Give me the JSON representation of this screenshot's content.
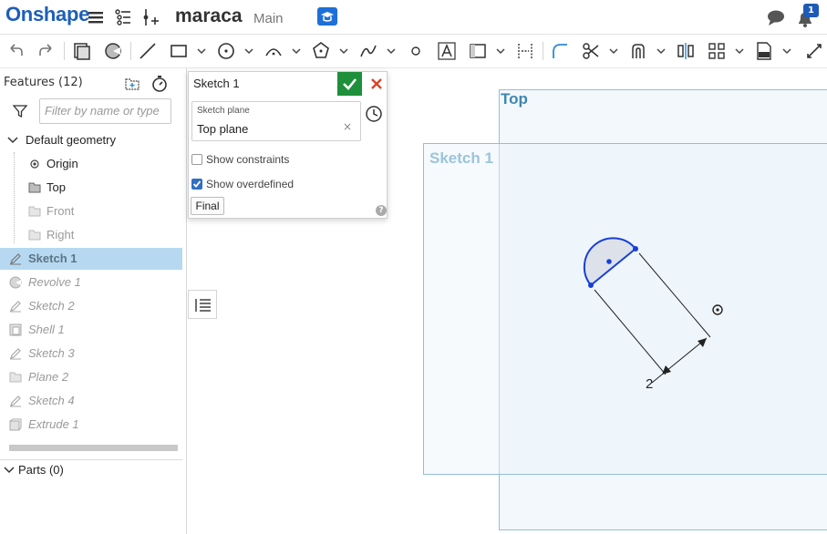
{
  "header": {
    "logo": "Onshape",
    "document_name": "maraca",
    "branch": "Main",
    "notification_count": "1"
  },
  "feature_panel": {
    "title": "Features (12)",
    "filter_placeholder": "Filter by name or type",
    "default_geometry_label": "Default geometry",
    "default_items": [
      "Origin",
      "Top",
      "Front",
      "Right"
    ],
    "features": [
      "Sketch 1",
      "Revolve 1",
      "Sketch 2",
      "Shell 1",
      "Sketch 3",
      "Plane 2",
      "Sketch 4",
      "Extrude 1"
    ],
    "parts_label": "Parts (0)"
  },
  "sketch_dialog": {
    "title": "Sketch 1",
    "plane_label": "Sketch plane",
    "plane_value": "Top plane",
    "show_constraints_label": "Show constraints",
    "show_constraints_checked": false,
    "show_overdefined_label": "Show overdefined",
    "show_overdefined_checked": true,
    "final_label": "Final"
  },
  "viewport": {
    "top_plane_label": "Top",
    "sketch_plane_label": "Sketch 1",
    "dimension_value": "2"
  },
  "colors": {
    "brand": "#1d5fb8",
    "selected_row": "#b6d9f1",
    "ok_button": "#1e8f3a",
    "cancel_x": "#d9452b",
    "sketch_entity": "#1a3fd6"
  }
}
